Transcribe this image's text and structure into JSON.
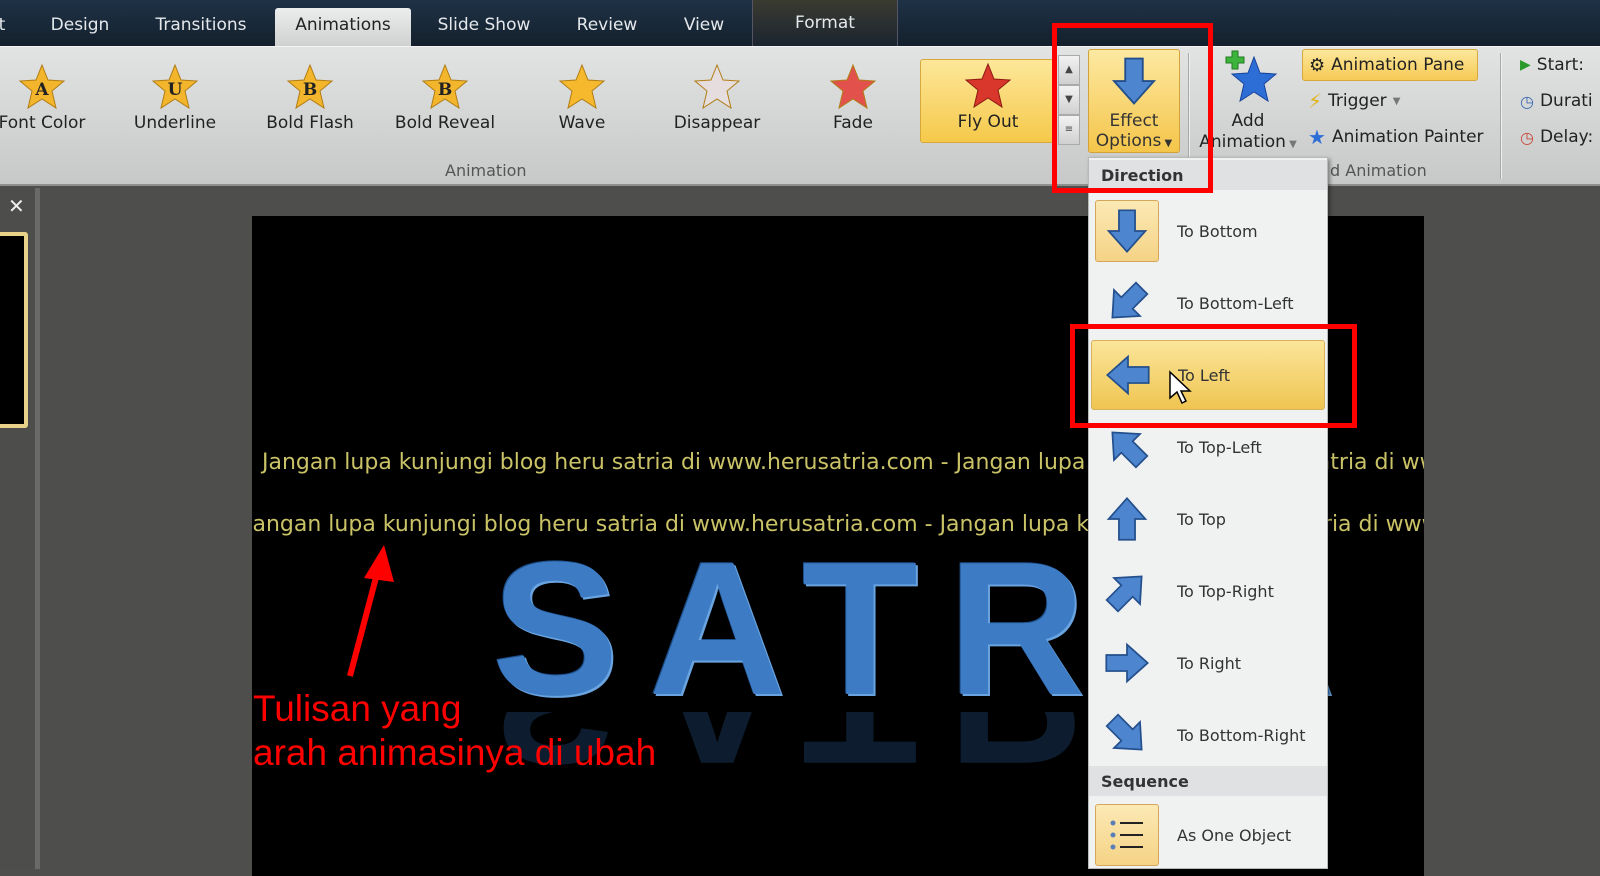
{
  "ribbon_tabs": [
    {
      "label": "t"
    },
    {
      "label": "Design"
    },
    {
      "label": "Transitions"
    },
    {
      "label": "Animations",
      "active": true
    },
    {
      "label": "Slide Show"
    },
    {
      "label": "Review"
    },
    {
      "label": "View"
    },
    {
      "label": "Format",
      "contextual": true
    }
  ],
  "animation_gallery": {
    "items": [
      {
        "label": "Font Color",
        "glyph": "A",
        "icon": "star-font-color-icon"
      },
      {
        "label": "Underline",
        "glyph": "U",
        "icon": "star-underline-icon"
      },
      {
        "label": "Bold Flash",
        "glyph": "B",
        "icon": "star-bold-flash-icon"
      },
      {
        "label": "Bold Reveal",
        "glyph": "B",
        "icon": "star-bold-reveal-icon"
      },
      {
        "label": "Wave",
        "glyph": "",
        "icon": "star-wave-icon"
      },
      {
        "label": "Disappear",
        "glyph": "",
        "icon": "star-disappear-icon"
      },
      {
        "label": "Fade",
        "glyph": "",
        "icon": "star-fade-icon"
      },
      {
        "label": "Fly Out",
        "glyph": "",
        "icon": "star-fly-out-icon",
        "selected": true
      }
    ],
    "group_label": "Animation"
  },
  "effect_options": {
    "line1": "Effect",
    "line2": "Options"
  },
  "advanced": {
    "add_animation_line1": "Add",
    "add_animation_line2": "Animation",
    "animation_pane": "Animation Pane",
    "trigger": "Trigger",
    "animation_painter": "Animation Painter",
    "group_label": "d Animation"
  },
  "timing": {
    "start": "Start:",
    "duration": "Durati",
    "delay": "Delay:"
  },
  "slide": {
    "marquee_line1": "Jangan lupa kunjungi blog heru  satria di www.herusatria.com - Jangan lupa kunjungi blog heru  satria di www.herusatria.com",
    "marquee_line2": "Jangan lupa kunjungi blog heru  satria di www.herusatria.com - Jangan lupa kunjungi blog heru  satria di www.herusatria.com",
    "title": "SATRIA"
  },
  "annotation": {
    "line1": "Tulisan yang",
    "line2": "arah animasinya di ubah",
    "color": "#ff0000"
  },
  "dropdown": {
    "direction_header": "Direction",
    "directions": [
      {
        "label": "To Bottom",
        "icon": "arrow-down-icon"
      },
      {
        "label": "To Bottom-Left",
        "icon": "arrow-down-left-icon"
      },
      {
        "label": "To Left",
        "icon": "arrow-left-icon",
        "hovered": true
      },
      {
        "label": "To Top-Left",
        "icon": "arrow-up-left-icon"
      },
      {
        "label": "To Top",
        "icon": "arrow-up-icon"
      },
      {
        "label": "To Top-Right",
        "icon": "arrow-up-right-icon"
      },
      {
        "label": "To Right",
        "icon": "arrow-right-icon"
      },
      {
        "label": "To Bottom-Right",
        "icon": "arrow-down-right-icon"
      }
    ],
    "selected_direction": "To Bottom",
    "sequence_header": "Sequence",
    "sequence": [
      {
        "label": "As One Object",
        "icon": "list-icon"
      }
    ]
  },
  "colors": {
    "accent": "#f4c54a",
    "arrow_blue": "#3d7cc4",
    "highlight_box": "#ff0000"
  }
}
